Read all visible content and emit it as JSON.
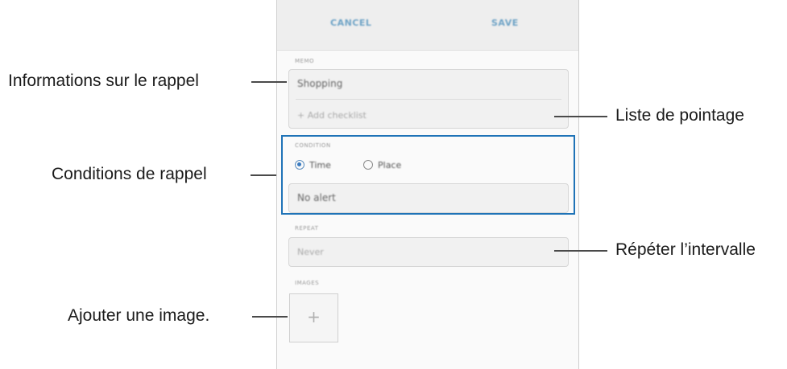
{
  "app": {
    "cancel_label": "CANCEL",
    "save_label": "SAVE"
  },
  "memo": {
    "section_label": "MEMO",
    "value": "Shopping",
    "checklist_placeholder": "+ Add checklist"
  },
  "condition": {
    "section_label": "CONDITION",
    "options": [
      {
        "label": "Time",
        "selected": true
      },
      {
        "label": "Place",
        "selected": false
      }
    ],
    "alert_value": "No alert"
  },
  "repeat": {
    "section_label": "REPEAT",
    "value": "Never"
  },
  "images": {
    "section_label": "IMAGES",
    "add_symbol": "+"
  },
  "callouts": {
    "info": "Informations sur le rappel",
    "conditions": "Conditions de rappel",
    "add_image": "Ajouter une image.",
    "checklist": "Liste de pointage",
    "repeat": "Répéter l’intervalle"
  },
  "colors": {
    "highlight_frame": "#1f73b7",
    "topbar_bg": "#eeeeee",
    "action_text": "#6ea3c6"
  }
}
